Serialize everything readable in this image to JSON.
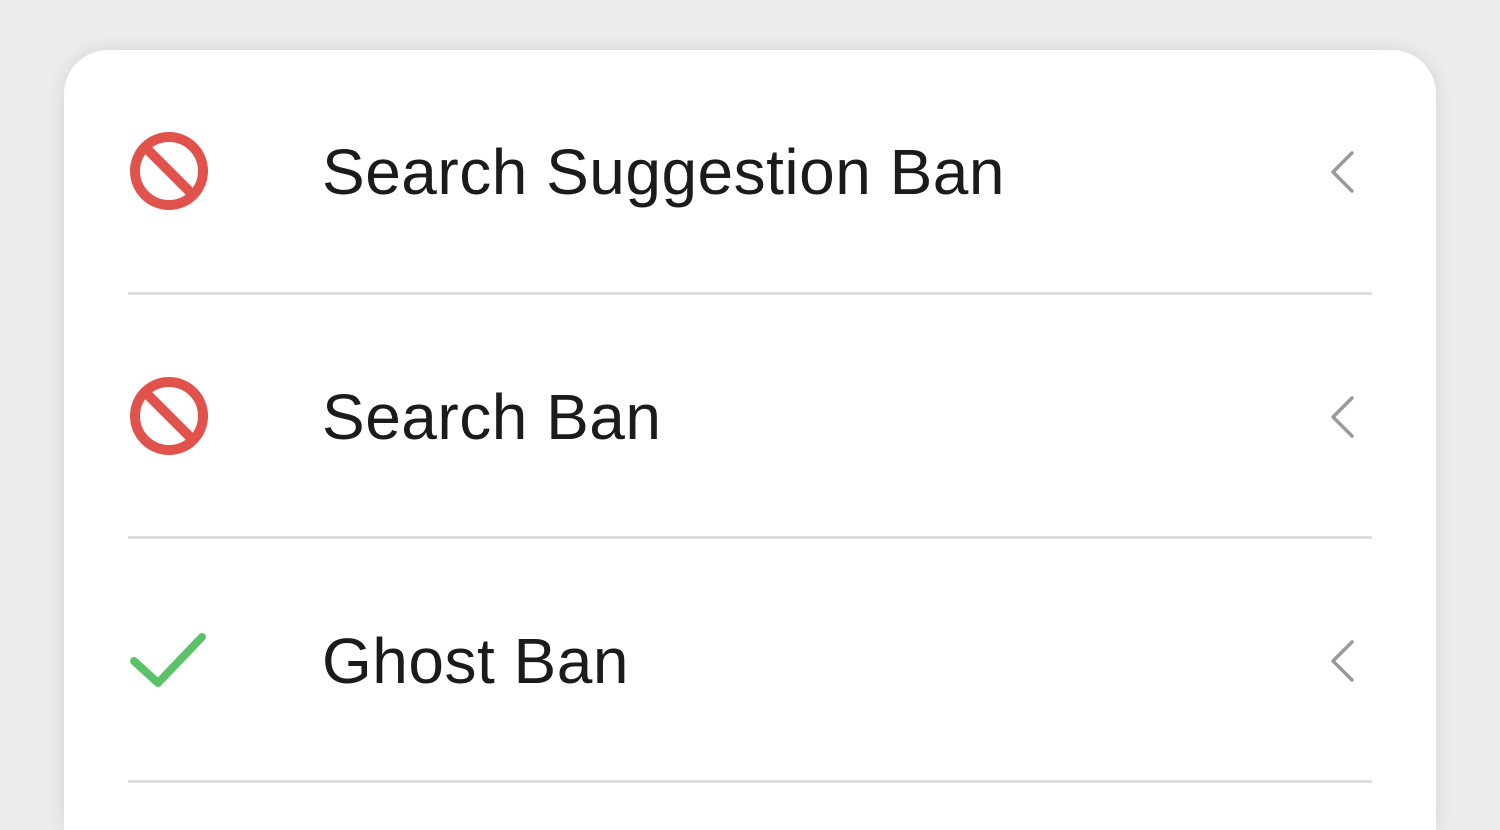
{
  "ban_checks": {
    "items": [
      {
        "label": "Search Suggestion Ban",
        "status": "banned",
        "icon": "prohibited-icon"
      },
      {
        "label": "Search Ban",
        "status": "banned",
        "icon": "prohibited-icon"
      },
      {
        "label": "Ghost Ban",
        "status": "clear",
        "icon": "checkmark-icon"
      }
    ],
    "expand_icon": "chevron-left-icon"
  },
  "colors": {
    "banned": "#e0524b",
    "clear": "#5cc26a",
    "chevron": "#9a9a9a",
    "divider": "#dedede",
    "background": "#ececec",
    "card": "#ffffff"
  }
}
